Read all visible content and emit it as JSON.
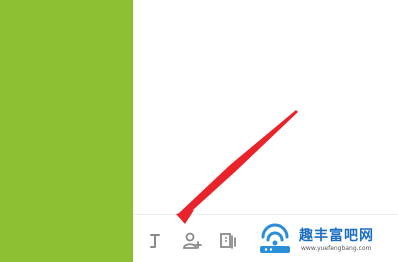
{
  "colors": {
    "side_panel": "#8dbf33",
    "arrow": "#e8242a",
    "toolbar_icon": "#8a8a8a",
    "watermark_accent": "#2a8fd8",
    "watermark_blue": "#1b6fc2"
  },
  "toolbar": {
    "icons": [
      "text-cursor-icon",
      "add-user-icon",
      "pages-icon"
    ]
  },
  "watermark": {
    "title": "趣丰富吧网",
    "url": "www.yuefengbang.com"
  }
}
